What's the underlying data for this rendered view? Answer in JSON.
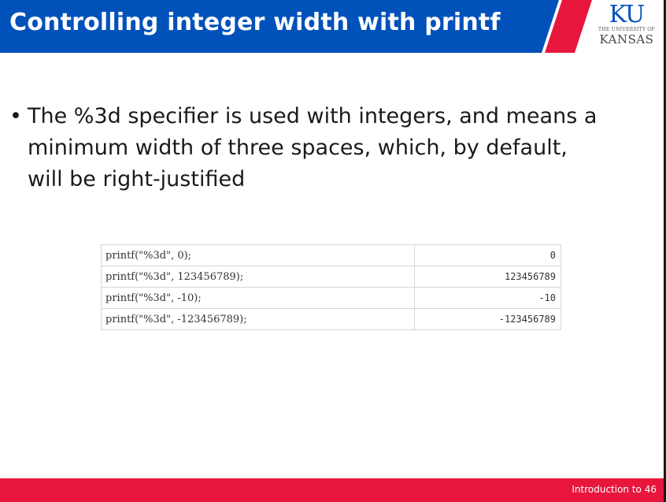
{
  "header": {
    "title": "Controlling integer width with printf",
    "colors": {
      "blue": "#0051ba",
      "red": "#e8163c"
    }
  },
  "logo": {
    "ku": "KU",
    "small_line": "THE UNIVERSITY OF",
    "name": "KANSAS"
  },
  "content": {
    "bullet_symbol": "•",
    "bullet_text": "The %3d specifier is used with integers, and means a minimum width of three spaces, which, by default, will be right-justified"
  },
  "code_rows": [
    {
      "command": "printf(\"%3d\", 0);",
      "output": "0"
    },
    {
      "command": "printf(\"%3d\", 123456789);",
      "output": "123456789"
    },
    {
      "command": "printf(\"%3d\", -10);",
      "output": "-10"
    },
    {
      "command": "printf(\"%3d\", -123456789);",
      "output": "-123456789"
    }
  ],
  "footer": {
    "text": "Introduction to",
    "page_number": "46"
  }
}
